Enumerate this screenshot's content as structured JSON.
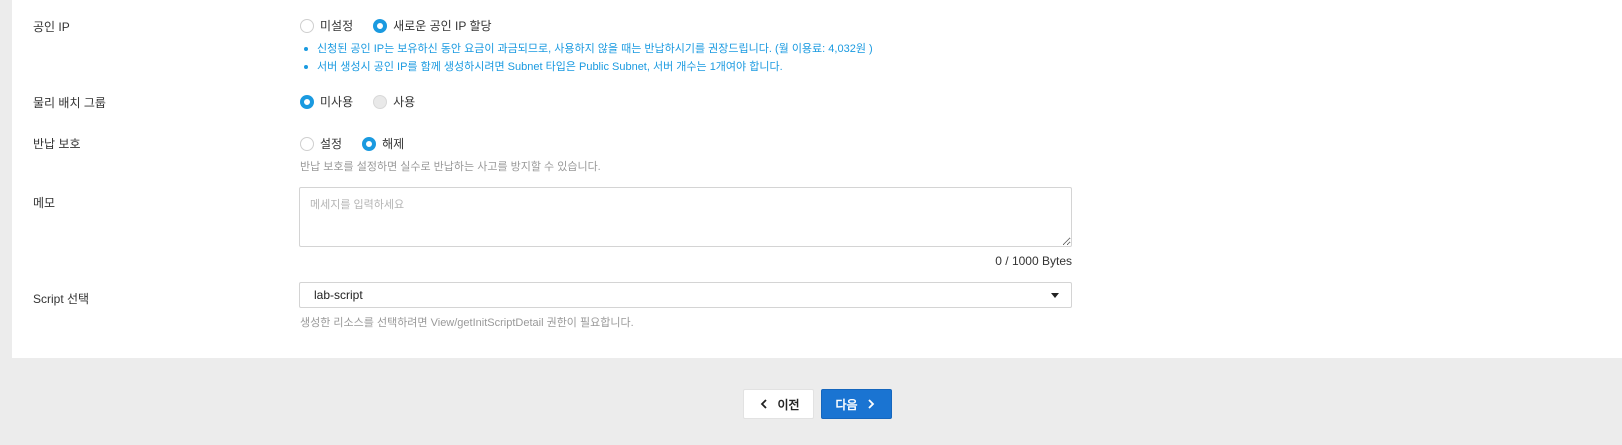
{
  "public_ip": {
    "label": "공인 IP",
    "options": [
      {
        "label": "미설정",
        "checked": false
      },
      {
        "label": "새로운 공인 IP 할당",
        "checked": true
      }
    ],
    "notes": [
      "신청된 공인 IP는 보유하신 동안 요금이 과금되므로, 사용하지 않을 때는 반납하시기를 권장드립니다. (월 이용료: 4,032원 )",
      "서버 생성시 공인 IP를 함께 생성하시려면 Subnet 타입은 Public Subnet, 서버 개수는 1개여야 합니다."
    ]
  },
  "placement_group": {
    "label": "물리 배치 그룹",
    "options": [
      {
        "label": "미사용",
        "checked": true
      },
      {
        "label": "사용",
        "checked": false,
        "disabled": true
      }
    ]
  },
  "return_protection": {
    "label": "반납 보호",
    "options": [
      {
        "label": "설정",
        "checked": false
      },
      {
        "label": "해제",
        "checked": true
      }
    ],
    "help": "반납 보호를 설정하면 실수로 반납하는 사고를 방지할 수 있습니다."
  },
  "memo": {
    "label": "메모",
    "value": "",
    "placeholder": "메세지를 입력하세요",
    "byte_count": "0 / 1000 Bytes"
  },
  "script": {
    "label": "Script 선택",
    "selected": "lab-script",
    "help": "생성한 리소스를 선택하려면 View/getInitScriptDetail 권한이 필요합니다."
  },
  "footer": {
    "prev_label": "이전",
    "next_label": "다음"
  },
  "colors": {
    "accent": "#1a9ae0",
    "primary_button": "#1a74d2",
    "background": "#ececec",
    "panel": "#ffffff"
  }
}
